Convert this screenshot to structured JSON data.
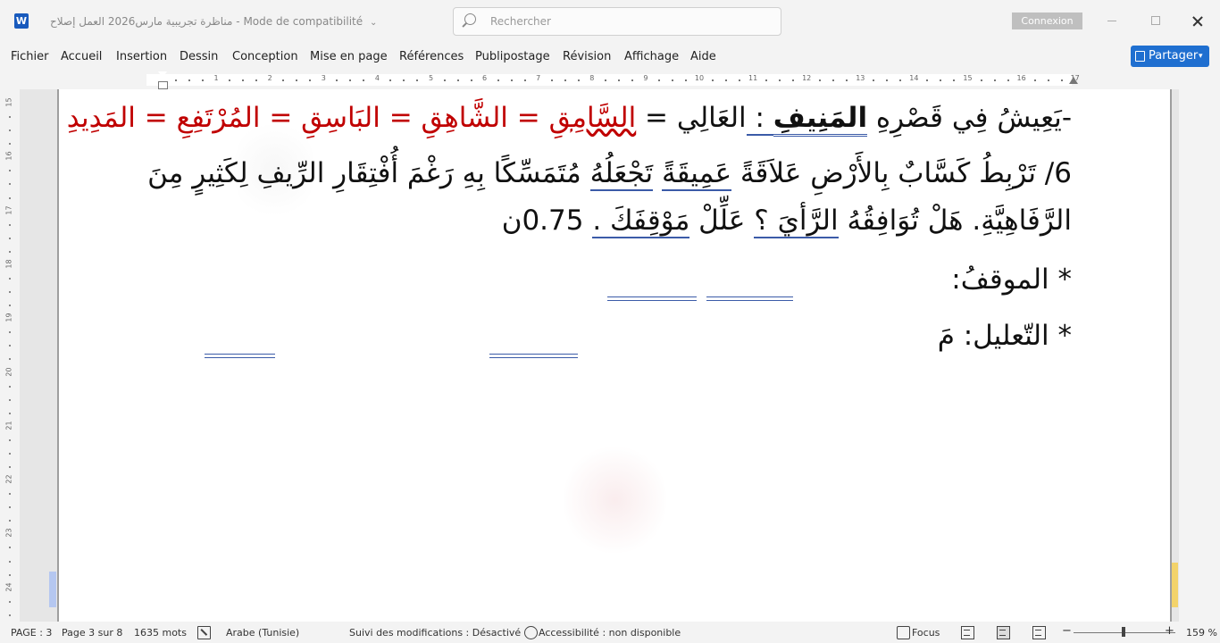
{
  "titlebar": {
    "app_logo": "W",
    "document_title": "مناظرة تجريبية مارس2026 العمل إصلاح",
    "mode": "Mode de compatibilité",
    "search_placeholder": "Rechercher",
    "signin_label": "Connexion"
  },
  "ribbon": {
    "tabs": [
      "Fichier",
      "Accueil",
      "Insertion",
      "Dessin",
      "Conception",
      "Mise en page",
      "Références",
      "Publipostage",
      "Révision",
      "Affichage",
      "Aide"
    ],
    "share_label": "Partager"
  },
  "ruler": {
    "horizontal_numbers": [
      "1",
      "2",
      "3",
      "4",
      "5",
      "6",
      "7",
      "8",
      "9",
      "10",
      "11",
      "12",
      "13",
      "14",
      "15",
      "16",
      "17"
    ],
    "vertical_numbers": [
      "15",
      "16",
      "17",
      "18",
      "19",
      "20",
      "21",
      "22",
      "23",
      "24"
    ]
  },
  "document": {
    "line1": {
      "dash": "-",
      "a": "يَعِيشُ فِي قَصْرِهِ ",
      "b": "المَنِيفِ",
      "c": " : ",
      "d": "العَالِي = ",
      "e": "السَّامِقِ",
      "f": " = الشَّاهِقِ = البَاسِقِ = المُرْتَفِعِ = المَدِيدِ"
    },
    "line2": {
      "a": "6/ تَرْبِطُ كَسَّابٌ بِالأَرْضِ عَلاَقَةً ",
      "b": "عَمِيقَةً",
      "c": "  ",
      "d": "تَجْعَلُهُ",
      "e": " مُتَمَسِّكًا بِهِ رَغْمَ أُفْتِقَارِ الرِّيفِ لِكَثِيرٍ مِنَ"
    },
    "line3": {
      "a": "الرَّفَاهِيَّةِ. هَلْ تُوَافِقُهُ ",
      "b": "الرَّأيَ ؟",
      "c": " عَلِّلْ ",
      "d": "مَوْقِفَكَ .",
      "e": " 0.75ن"
    },
    "line4": "* الموقفُ:",
    "line5": "* التّعليل: مَ"
  },
  "statusbar": {
    "page": "PAGE : 3",
    "page_of": "Page 3 sur 8",
    "words": "1635 mots",
    "language": "Arabe (Tunisie)",
    "track_changes": "Suivi des modifications : Désactivé",
    "accessibility": "Accessibilité : non disponible",
    "focus": "Focus",
    "zoom_minus": "−",
    "zoom_plus": "+",
    "zoom": "159 %",
    "zoom_level_percent": 159
  }
}
